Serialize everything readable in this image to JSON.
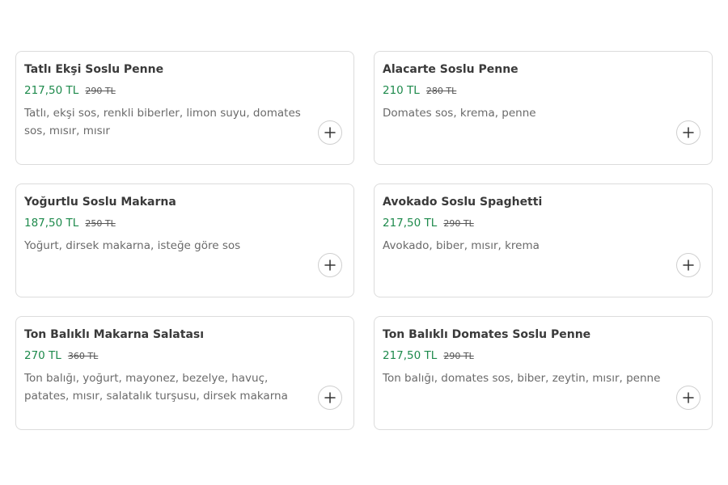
{
  "products": [
    {
      "name": "Tatlı Ekşi Soslu Penne",
      "price": "217,50 TL",
      "old_price": "290 TL",
      "description": "Tatlı, ekşi sos, renkli biberler, limon suyu, domates sos, mısır, mısır",
      "add_icon": "plus-icon"
    },
    {
      "name": "Alacarte Soslu Penne",
      "price": "210 TL",
      "old_price": "280 TL",
      "description": "Domates sos, krema, penne",
      "add_icon": "plus-icon"
    },
    {
      "name": "Yoğurtlu Soslu Makarna",
      "price": "187,50 TL",
      "old_price": "250 TL",
      "description": "Yoğurt, dirsek makarna, isteğe göre sos",
      "add_icon": "plus-icon"
    },
    {
      "name": "Avokado Soslu Spaghetti",
      "price": "217,50 TL",
      "old_price": "290 TL",
      "description": "Avokado, biber, mısır, krema",
      "add_icon": "plus-icon"
    },
    {
      "name": "Ton Balıklı Makarna Salatası",
      "price": "270 TL",
      "old_price": "360 TL",
      "description": "Ton balığı, yoğurt, mayonez, bezelye, havuç, patates, mısır, salatalık turşusu, dirsek makarna",
      "add_icon": "plus-icon"
    },
    {
      "name": "Ton Balıklı Domates Soslu Penne",
      "price": "217,50 TL",
      "old_price": "290 TL",
      "description": "Ton balığı, domates sos, biber, zeytin, mısır, penne",
      "add_icon": "plus-icon"
    }
  ],
  "colors": {
    "price_green": "#1e8a4c",
    "card_border": "#dcdcdc",
    "title_text": "#3a3a3a",
    "description_text": "#6a6a6a"
  }
}
